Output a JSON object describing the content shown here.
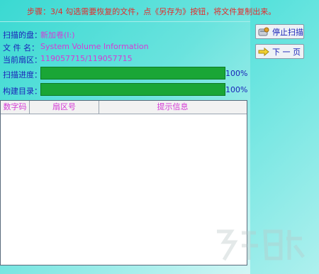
{
  "step_message": "步骤：3/4 勾选需要恢复的文件，点《另存为》按钮，将文件复制出来。",
  "fields": {
    "disk_label": "扫描的盘：",
    "disk_value": "新加卷(I:)",
    "filename_label": "文 件 名：",
    "filename_value": "System Volume Information",
    "sector_label": "当前扇区：",
    "sector_value": "119057715/119057715"
  },
  "progress": {
    "scan_label": "扫描进度：",
    "scan_percent": 100,
    "scan_text": "100%",
    "build_label": "构建目录：",
    "build_percent": 100,
    "build_text": "100%"
  },
  "table": {
    "columns": [
      "数字码",
      "扇区号",
      "提示信息"
    ],
    "rows": []
  },
  "buttons": {
    "stop_scan": "停止扫描",
    "next_page": "下 一 页"
  },
  "colors": {
    "progress_fill": "#1aa636",
    "label_text": "#1a23b8",
    "value_text": "#d43bd6",
    "step_text": "#e32b2b"
  },
  "icons": {
    "stop_scan": "disk-stop-icon",
    "next_page": "arrow-right-icon"
  }
}
